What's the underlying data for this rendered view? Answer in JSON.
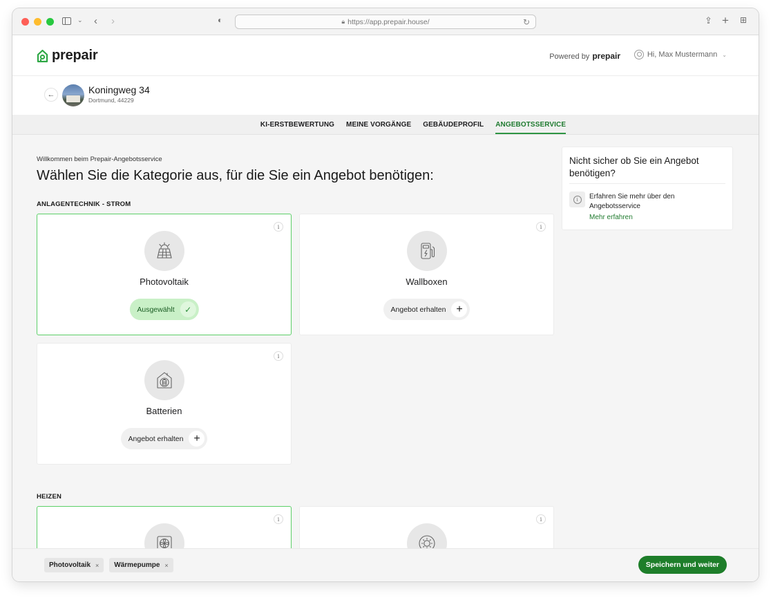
{
  "browser": {
    "url": "https://app.prepair.house/"
  },
  "header": {
    "logo_text": "prepair",
    "powered_by": "Powered by",
    "powered_brand": "prepair",
    "user_greeting": "Hi, Max Mustermann"
  },
  "property": {
    "title": "Koningweg 34",
    "subtitle": "Dortmund, 44229"
  },
  "tabs": [
    {
      "label": "KI-ERSTBEWERTUNG",
      "active": false
    },
    {
      "label": "MEINE VORGÄNGE",
      "active": false
    },
    {
      "label": "GEBÄUDEPROFIL",
      "active": false
    },
    {
      "label": "ANGEBOTSSERVICE",
      "active": true
    }
  ],
  "main": {
    "welcome": "Willkommen beim Prepair-Angebotsservice",
    "heading": "Wählen Sie die Kategorie aus, für die Sie ein Angebot benötigen:",
    "sections": [
      {
        "label": "ANLAGENTECHNIK - STROM",
        "cards": [
          {
            "name": "Photovoltaik",
            "button": "Ausgewählt",
            "selected": true,
            "icon": "solar-panel-icon"
          },
          {
            "name": "Wallboxen",
            "button": "Angebot erhalten",
            "selected": false,
            "icon": "ev-charger-icon"
          },
          {
            "name": "Batterien",
            "button": "Angebot erhalten",
            "selected": false,
            "icon": "home-battery-icon"
          }
        ]
      },
      {
        "label": "HEIZEN",
        "cards": [
          {
            "name": "Wärmepumpe",
            "selected": true,
            "icon": "heat-pump-icon"
          },
          {
            "name": "",
            "selected": false,
            "icon": "sun-icon"
          }
        ]
      }
    ],
    "info_symbol": "i"
  },
  "aside": {
    "title": "Nicht sicher ob Sie ein Angebot benötigen?",
    "text": "Erfahren Sie mehr über den Angebotsservice",
    "link": "Mehr erfahren",
    "info_symbol": "i"
  },
  "footer": {
    "chips": [
      "Photovoltaik",
      "Wärmepumpe"
    ],
    "remove_symbol": "×",
    "save_label": "Speichern und weiter"
  },
  "colors": {
    "brand_green": "#1e7e2a",
    "selected_border": "#5ccf68",
    "selected_button_bg": "#c9f0c7",
    "active_tab": "#1e7a2f"
  }
}
